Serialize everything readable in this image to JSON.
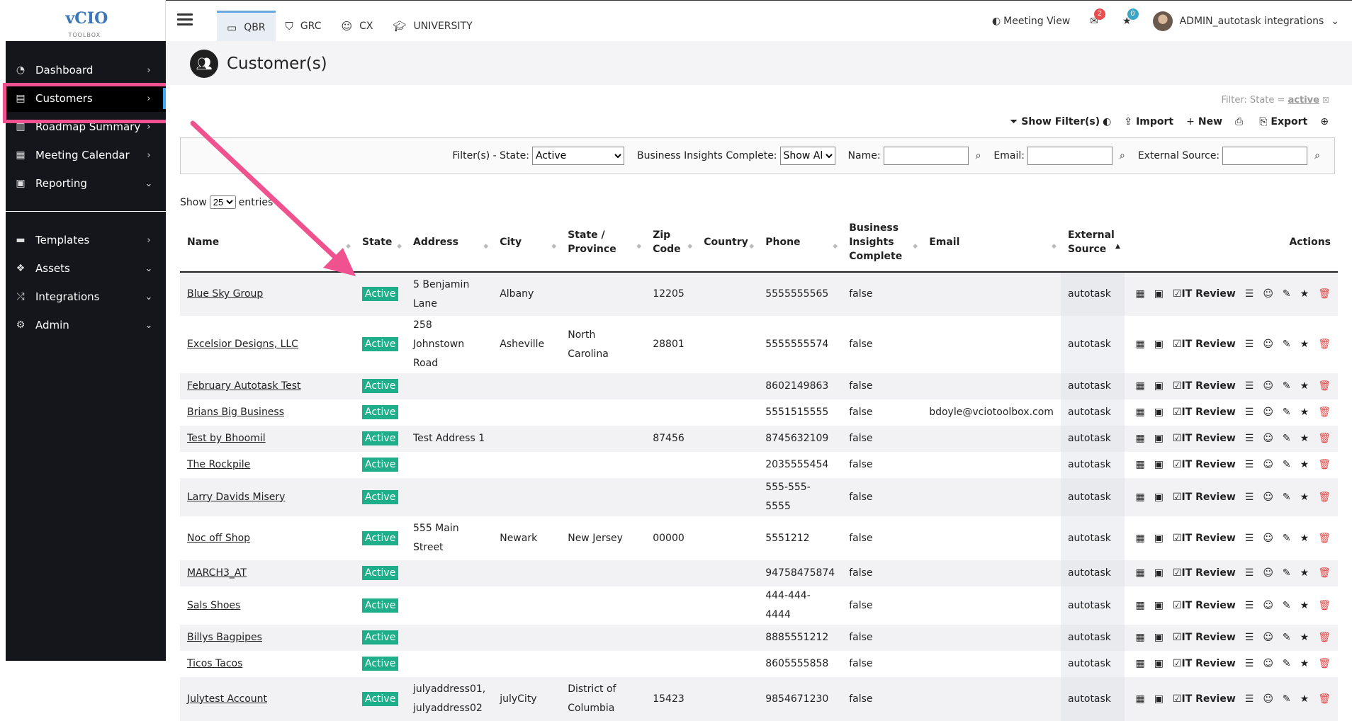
{
  "sidebar": {
    "logo_text": "vCIO",
    "logo_sub": "TOOLBOX",
    "items": [
      {
        "label": "Dashboard",
        "icon": "tachometer-icon",
        "chev": "›"
      },
      {
        "label": "Customers",
        "icon": "address-card-icon",
        "chev": "›"
      },
      {
        "label": "Roadmap Summary",
        "icon": "map-icon",
        "chev": "›"
      },
      {
        "label": "Meeting Calendar",
        "icon": "calendar-icon",
        "chev": "›"
      },
      {
        "label": "Reporting",
        "icon": "report-icon",
        "chev": "⌄"
      },
      {
        "label": "Templates",
        "icon": "template-icon",
        "chev": "›"
      },
      {
        "label": "Assets",
        "icon": "cubes-icon",
        "chev": "⌄"
      },
      {
        "label": "Integrations",
        "icon": "shuffle-icon",
        "chev": "⌄"
      },
      {
        "label": "Admin",
        "icon": "cogs-icon",
        "chev": "⌄"
      }
    ]
  },
  "topbar": {
    "tabs": [
      {
        "label": "QBR",
        "icon": "laptop-icon"
      },
      {
        "label": "GRC",
        "icon": "shield-icon"
      },
      {
        "label": "CX",
        "icon": "smile-icon"
      },
      {
        "label": "UNIVERSITY",
        "icon": "graduation-cap-icon"
      }
    ],
    "meeting_view": "Meeting View",
    "mail_count": "2",
    "star_count": "0",
    "user_name": "ADMIN_autotask integrations"
  },
  "page": {
    "title": "Customer(s)",
    "filter_note_prefix": "Filter: State = ",
    "filter_note_value": "active",
    "actions": {
      "show_filters": "Show Filter(s)",
      "import": "Import",
      "new": "New",
      "export": "Export"
    },
    "filters": {
      "state_label": "Filter(s) - State:",
      "state_value": "Active",
      "bi_label": "Business Insights Complete:",
      "bi_value": "Show All",
      "name_label": "Name:",
      "email_label": "Email:",
      "ext_label": "External Source:"
    },
    "show_label": "Show",
    "show_value": "25",
    "entries_label": "entries"
  },
  "table": {
    "headers": [
      "Name",
      "State",
      "Address",
      "City",
      "State / Province",
      "Zip Code",
      "Country",
      "Phone",
      "Business Insights Complete",
      "Email",
      "External Source",
      "Actions"
    ],
    "it_review_label": "IT Review",
    "rows": [
      {
        "name": "Blue Sky Group",
        "state": "Active",
        "address": "5 Benjamin Lane",
        "city": "Albany",
        "province": "",
        "zip": "12205",
        "country": "",
        "phone": "5555555565",
        "bi": "false",
        "email": "",
        "ext": "autotask",
        "tall": true
      },
      {
        "name": "Excelsior Designs, LLC",
        "state": "Active",
        "address": "258 Johnstown Road",
        "city": "Asheville",
        "province": "North Carolina",
        "zip": "28801",
        "country": "",
        "phone": "5555555574",
        "bi": "false",
        "email": "",
        "ext": "autotask",
        "tall": true
      },
      {
        "name": "February Autotask Test",
        "state": "Active",
        "address": "",
        "city": "",
        "province": "",
        "zip": "",
        "country": "",
        "phone": "8602149863",
        "bi": "false",
        "email": "",
        "ext": "autotask",
        "tall": false
      },
      {
        "name": "Brians Big Business",
        "state": "Active",
        "address": "",
        "city": "",
        "province": "",
        "zip": "",
        "country": "",
        "phone": "5551515555",
        "bi": "false",
        "email": "bdoyle@vciotoolbox.com",
        "ext": "autotask",
        "tall": false
      },
      {
        "name": "Test by Bhoomil",
        "state": "Active",
        "address": "Test Address 1",
        "city": "",
        "province": "",
        "zip": "87456",
        "country": "",
        "phone": "8745632109",
        "bi": "false",
        "email": "",
        "ext": "autotask",
        "tall": false
      },
      {
        "name": "The Rockpile",
        "state": "Active",
        "address": "",
        "city": "",
        "province": "",
        "zip": "",
        "country": "",
        "phone": "2035555454",
        "bi": "false",
        "email": "",
        "ext": "autotask",
        "tall": false
      },
      {
        "name": "Larry Davids Misery",
        "state": "Active",
        "address": "",
        "city": "",
        "province": "",
        "zip": "",
        "country": "",
        "phone": "555-555-5555",
        "bi": "false",
        "email": "",
        "ext": "autotask",
        "tall": false
      },
      {
        "name": "Noc off Shop",
        "state": "Active",
        "address": "555 Main Street",
        "city": "Newark",
        "province": "New Jersey",
        "zip": "00000",
        "country": "",
        "phone": "5551212",
        "bi": "false",
        "email": "",
        "ext": "autotask",
        "tall": true
      },
      {
        "name": "MARCH3_AT",
        "state": "Active",
        "address": "",
        "city": "",
        "province": "",
        "zip": "",
        "country": "",
        "phone": "94758475874",
        "bi": "false",
        "email": "",
        "ext": "autotask",
        "tall": false
      },
      {
        "name": "Sals Shoes",
        "state": "Active",
        "address": "",
        "city": "",
        "province": "",
        "zip": "",
        "country": "",
        "phone": "444-444-4444",
        "bi": "false",
        "email": "",
        "ext": "autotask",
        "tall": false
      },
      {
        "name": "Billys Bagpipes",
        "state": "Active",
        "address": "",
        "city": "",
        "province": "",
        "zip": "",
        "country": "",
        "phone": "8885551212",
        "bi": "false",
        "email": "",
        "ext": "autotask",
        "tall": false
      },
      {
        "name": "Ticos Tacos",
        "state": "Active",
        "address": "",
        "city": "",
        "province": "",
        "zip": "",
        "country": "",
        "phone": "8605555858",
        "bi": "false",
        "email": "",
        "ext": "autotask",
        "tall": false
      },
      {
        "name": "Julytest Account",
        "state": "Active",
        "address": "julyaddress01, julyaddress02",
        "city": "julyCity",
        "province": "District of Columbia",
        "zip": "15423",
        "country": "",
        "phone": "9854671230",
        "bi": "false",
        "email": "",
        "ext": "autotask",
        "tall": true
      }
    ]
  },
  "colors": {
    "active_badge": "#1fae8a",
    "highlight": "#f0528f",
    "sidebar_bg": "#15161b"
  }
}
